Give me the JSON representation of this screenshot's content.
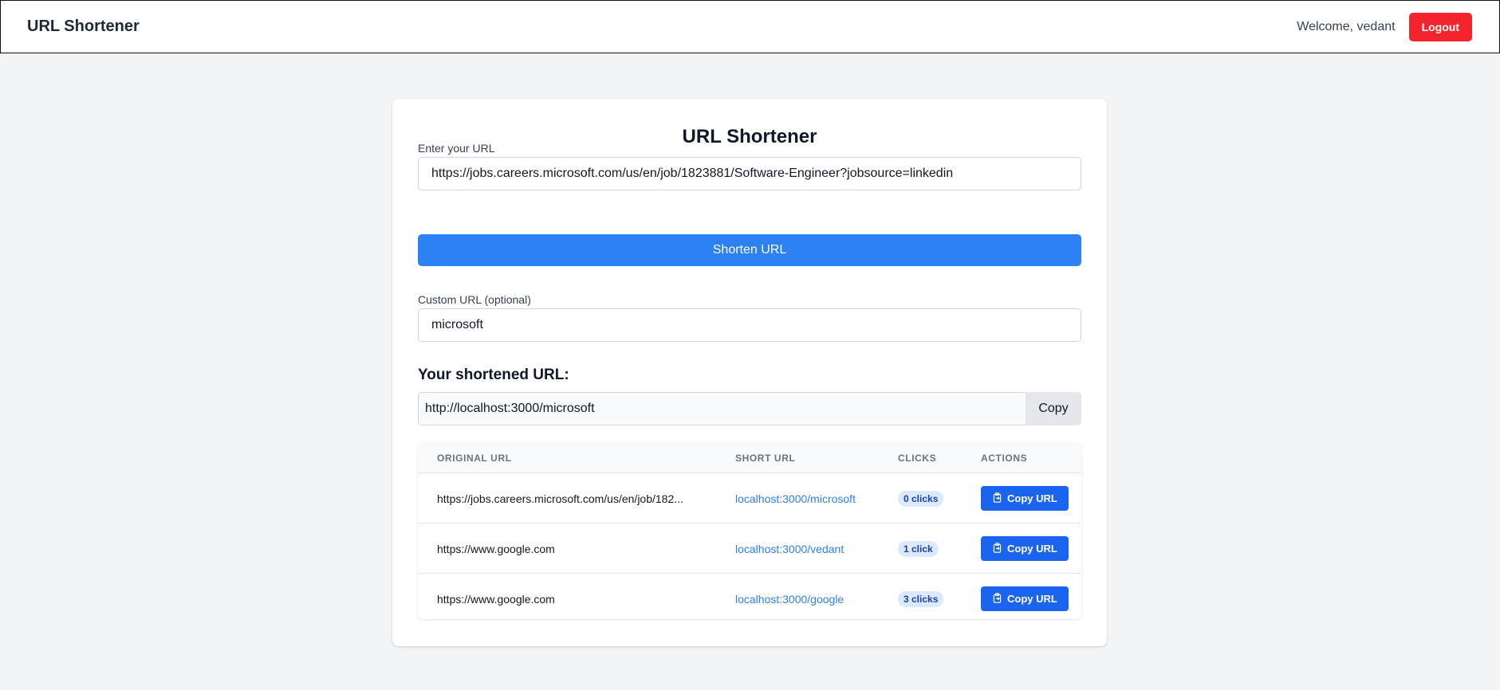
{
  "navbar": {
    "brand": "URL Shortener",
    "welcome": "Welcome, vedant",
    "logout_label": "Logout"
  },
  "card": {
    "title": "URL Shortener",
    "url_label": "Enter your URL",
    "url_value": "https://jobs.careers.microsoft.com/us/en/job/1823881/Software-Engineer?jobsource=linkedin",
    "shorten_label": "Shorten URL",
    "custom_label": "Custom URL (optional)",
    "custom_value": "microsoft",
    "shortened_heading": "Your shortened URL:",
    "shortened_value": "http://localhost:3000/microsoft",
    "copy_label": "Copy"
  },
  "table": {
    "headers": [
      "ORIGINAL URL",
      "SHORT URL",
      "CLICKS",
      "ACTIONS"
    ],
    "rows": [
      {
        "original": "https://jobs.careers.microsoft.com/us/en/job/182...",
        "short": "localhost:3000/microsoft",
        "clicks": "0 clicks",
        "action": "Copy URL"
      },
      {
        "original": "https://www.google.com",
        "short": "localhost:3000/vedant",
        "clicks": "1 click",
        "action": "Copy URL"
      },
      {
        "original": "https://www.google.com",
        "short": "localhost:3000/google",
        "clicks": "3 clicks",
        "action": "Copy URL"
      }
    ]
  },
  "icons": {
    "copy_action_icon": "clipboard-icon"
  },
  "colors": {
    "primary": "#2e81f5",
    "action": "#1a64ef",
    "logout": "#f4242f",
    "background": "#f3f4f6"
  }
}
